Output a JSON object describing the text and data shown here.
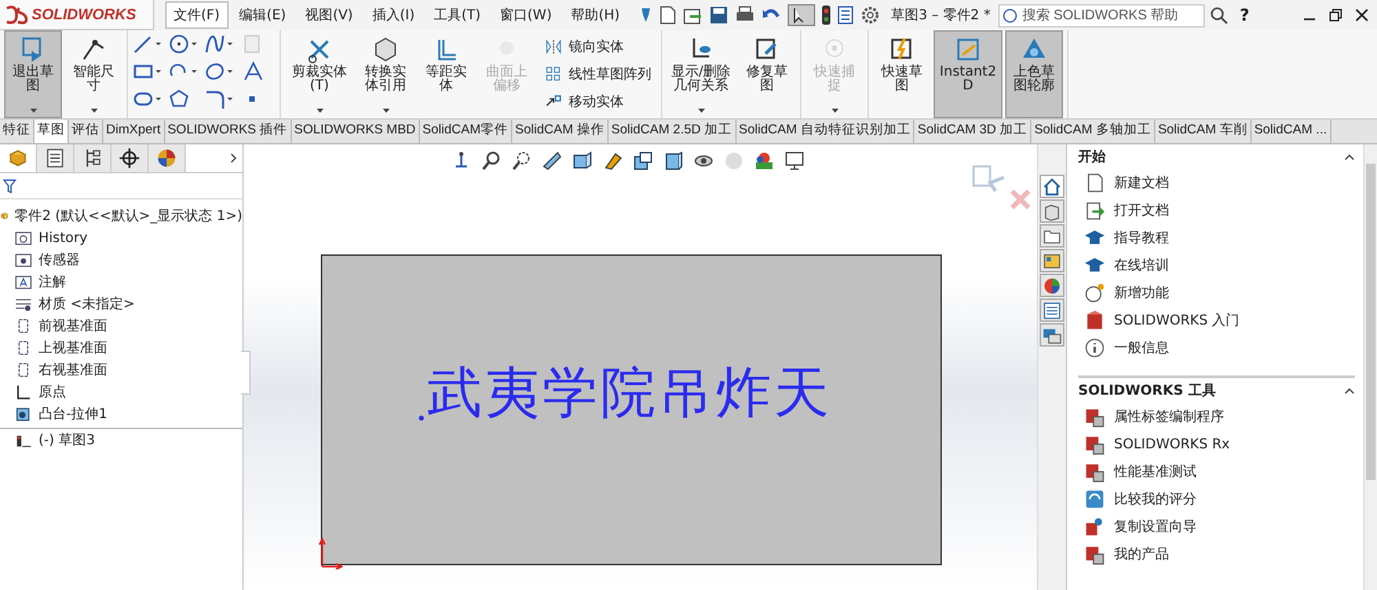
{
  "brand": "SOLIDWORKS",
  "menu": [
    {
      "label": "文件(F)",
      "selected": true
    },
    {
      "label": "编辑(E)",
      "selected": false
    },
    {
      "label": "视图(V)",
      "selected": false
    },
    {
      "label": "插入(I)",
      "selected": false
    },
    {
      "label": "工具(T)",
      "selected": false
    },
    {
      "label": "窗口(W)",
      "selected": false
    },
    {
      "label": "帮助(H)",
      "selected": false
    }
  ],
  "doc_title": "草图3 – 零件2 *",
  "search": {
    "placeholder": "搜索 SOLIDWORKS 帮助"
  },
  "help_button": "?",
  "ribbon": {
    "groups": [
      {
        "items": [
          {
            "kind": "large",
            "label": "退出草图",
            "selected": true,
            "disabled": false,
            "dropdown": true
          },
          {
            "kind": "large",
            "label": "智能尺寸",
            "selected": false,
            "disabled": false,
            "dropdown": true
          }
        ]
      },
      {
        "items": [
          {
            "kind": "tool-grid"
          }
        ]
      },
      {
        "items": [
          {
            "kind": "large",
            "label": "剪裁实体(T)",
            "selected": false,
            "disabled": false,
            "dropdown": true
          },
          {
            "kind": "large",
            "label": "转换实体引用",
            "selected": false,
            "disabled": false,
            "dropdown": true
          },
          {
            "kind": "large",
            "label": "等距实体",
            "selected": false,
            "disabled": false,
            "dropdown": false
          },
          {
            "kind": "large",
            "label": "曲面上偏移",
            "selected": false,
            "disabled": true,
            "dropdown": false
          },
          {
            "kind": "list",
            "rows": [
              {
                "label": "镜向实体"
              },
              {
                "label": "线性草图阵列"
              },
              {
                "label": "移动实体"
              }
            ]
          }
        ]
      },
      {
        "items": [
          {
            "kind": "large",
            "label": "显示/删除几何关系",
            "selected": false,
            "disabled": false,
            "dropdown": true
          },
          {
            "kind": "large",
            "label": "修复草图",
            "selected": false,
            "disabled": false,
            "dropdown": false
          }
        ]
      },
      {
        "items": [
          {
            "kind": "large",
            "label": "快速捕捉",
            "selected": false,
            "disabled": true,
            "dropdown": true
          }
        ]
      },
      {
        "items": [
          {
            "kind": "large",
            "label": "快速草图",
            "selected": false,
            "disabled": false,
            "dropdown": false
          },
          {
            "kind": "large",
            "label": "Instant2D",
            "selected": true,
            "disabled": false,
            "dropdown": false
          },
          {
            "kind": "large",
            "label": "上色草图轮廓",
            "selected": true,
            "disabled": false,
            "dropdown": false
          }
        ]
      }
    ]
  },
  "tabs": [
    {
      "label": "特征",
      "selected": false
    },
    {
      "label": "草图",
      "selected": true
    },
    {
      "label": "评估",
      "selected": false
    },
    {
      "label": "DimXpert",
      "selected": false
    },
    {
      "label": "SOLIDWORKS 插件",
      "selected": false
    },
    {
      "label": "SOLIDWORKS MBD",
      "selected": false
    },
    {
      "label": "SolidCAM零件",
      "selected": false
    },
    {
      "label": "SolidCAM 操作",
      "selected": false
    },
    {
      "label": "SolidCAM 2.5D 加工",
      "selected": false
    },
    {
      "label": "SolidCAM 自动特征识别加工",
      "selected": false
    },
    {
      "label": "SolidCAM 3D 加工",
      "selected": false
    },
    {
      "label": "SolidCAM 多轴加工",
      "selected": false
    },
    {
      "label": "SolidCAM 车削",
      "selected": false
    },
    {
      "label": "SolidCAM ...",
      "selected": false
    }
  ],
  "left_panel": {
    "tabs": [
      {
        "kind": "tree",
        "selected": true
      },
      {
        "kind": "property",
        "selected": false
      },
      {
        "kind": "config",
        "selected": false
      },
      {
        "kind": "dimxpert",
        "selected": false
      },
      {
        "kind": "display",
        "selected": false
      }
    ],
    "tree": {
      "label": "零件2  (默认<<默认>_显示状态 1>)",
      "kind": "part",
      "children": [
        {
          "label": "History",
          "kind": "history"
        },
        {
          "label": "传感器",
          "kind": "sensor"
        },
        {
          "label": "注解",
          "kind": "annotation"
        },
        {
          "label": "材质 <未指定>",
          "kind": "material"
        },
        {
          "label": "前视基准面",
          "kind": "plane"
        },
        {
          "label": "上视基准面",
          "kind": "plane"
        },
        {
          "label": "右视基准面",
          "kind": "plane"
        },
        {
          "label": "原点",
          "kind": "origin"
        },
        {
          "label": "凸台-拉伸1",
          "kind": "extrude"
        },
        {
          "label": "(-) 草图3",
          "kind": "sketch"
        }
      ]
    }
  },
  "sketch": {
    "text": "武夷学院吊炸天"
  },
  "task_pane": {
    "tabs": [
      {
        "kind": "home",
        "selected": true
      },
      {
        "kind": "library",
        "selected": false
      },
      {
        "kind": "explorer",
        "selected": false
      },
      {
        "kind": "palette",
        "selected": false
      },
      {
        "kind": "appearance",
        "selected": false
      },
      {
        "kind": "properties",
        "selected": false
      },
      {
        "kind": "forum",
        "selected": false
      }
    ],
    "sections": [
      {
        "title": "开始",
        "expanded": true,
        "items": [
          {
            "label": "新建文档",
            "kind": "new"
          },
          {
            "label": "打开文档",
            "kind": "open"
          },
          {
            "label": "指导教程",
            "kind": "tutorial"
          },
          {
            "label": "在线培训",
            "kind": "tutorial"
          },
          {
            "label": "新增功能",
            "kind": "whatsnew"
          },
          {
            "label": "SOLIDWORKS 入门",
            "kind": "intro"
          },
          {
            "label": "一般信息",
            "kind": "info"
          }
        ]
      },
      {
        "title": "SOLIDWORKS 工具",
        "expanded": true,
        "items": [
          {
            "label": "属性标签编制程序",
            "kind": "tool"
          },
          {
            "label": "SOLIDWORKS Rx",
            "kind": "tool"
          },
          {
            "label": "性能基准测试",
            "kind": "tool"
          },
          {
            "label": "比较我的评分",
            "kind": "compare"
          },
          {
            "label": "复制设置向导",
            "kind": "copy"
          },
          {
            "label": "我的产品",
            "kind": "tool"
          }
        ]
      }
    ]
  }
}
